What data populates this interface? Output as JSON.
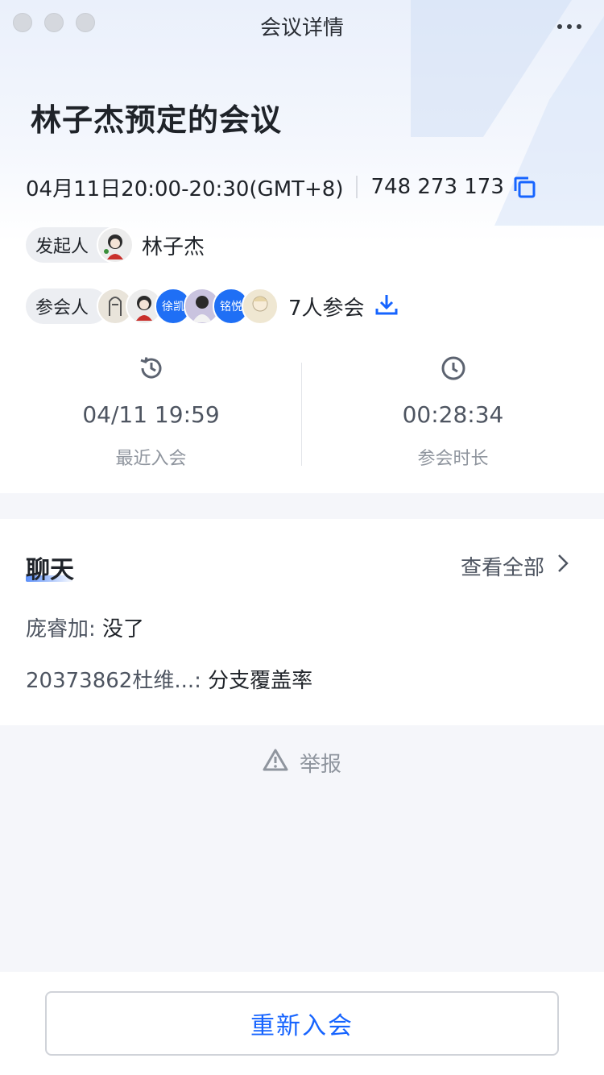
{
  "window": {
    "title": "会议详情"
  },
  "meeting": {
    "title": "林子杰预定的会议",
    "time": "04月11日20:00-20:30(GMT+8)",
    "meeting_id": "748 273 173"
  },
  "host": {
    "tag": "发起人",
    "name": "林子杰"
  },
  "attendees": {
    "tag": "参会人",
    "count_label": "7人参会",
    "avatars": [
      {
        "text": "",
        "color": "#e9e4da"
      },
      {
        "text": "",
        "color": "#e9e9e9"
      },
      {
        "text": "徐凯",
        "color": "#1f6ff5"
      },
      {
        "text": "",
        "color": "#c9c3df"
      },
      {
        "text": "铭悦",
        "color": "#1f6ff5"
      },
      {
        "text": "",
        "color": "#efe7d2"
      }
    ]
  },
  "stats": {
    "last_join": {
      "value": "04/11 19:59",
      "label": "最近入会"
    },
    "duration": {
      "value": "00:28:34",
      "label": "参会时长"
    }
  },
  "chat": {
    "title": "聊天",
    "view_all": "查看全部",
    "messages": [
      {
        "sender": "庞睿加:",
        "text": " 没了"
      },
      {
        "sender": "20373862杜维...:",
        "text": " 分支覆盖率"
      }
    ]
  },
  "report": {
    "label": "举报"
  },
  "actions": {
    "rejoin": "重新入会"
  },
  "colors": {
    "accent": "#1664ff",
    "muted": "#8f959e"
  }
}
